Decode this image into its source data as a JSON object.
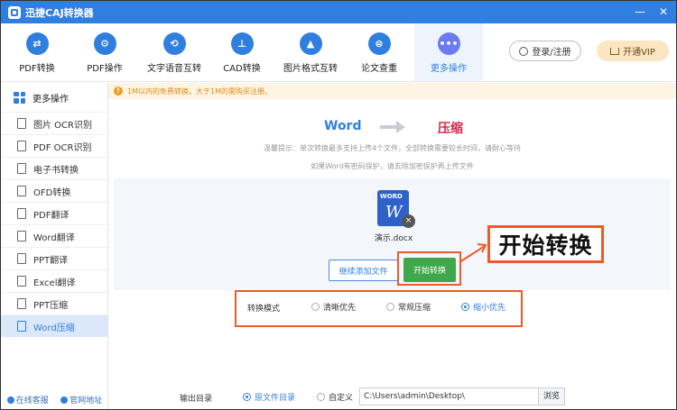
{
  "app": {
    "title": "迅捷CAJ转换器"
  },
  "window_controls": {
    "minimize": "—",
    "close": "✕"
  },
  "toolbar": {
    "tools": [
      {
        "label": "PDF转换",
        "icon": "swap-icon",
        "glyph": "⇄"
      },
      {
        "label": "PDF操作",
        "icon": "gear-icon",
        "glyph": "⚙"
      },
      {
        "label": "文字语音互转",
        "icon": "voice-icon",
        "glyph": "⟲"
      },
      {
        "label": "CAD转换",
        "icon": "cad-icon",
        "glyph": "⊥"
      },
      {
        "label": "图片格式互转",
        "icon": "image-icon",
        "glyph": "▲"
      },
      {
        "label": "论文查重",
        "icon": "check-icon",
        "glyph": "⊜"
      },
      {
        "label": "更多操作",
        "icon": "more-icon",
        "glyph": "•••"
      }
    ],
    "login_label": "登录/注册",
    "vip_label": "开通VIP"
  },
  "sidebar": {
    "header": "更多操作",
    "items": [
      {
        "label": "图片 OCR识别"
      },
      {
        "label": "PDF OCR识别"
      },
      {
        "label": "电子书转换"
      },
      {
        "label": "OFD转换"
      },
      {
        "label": "PDF翻译"
      },
      {
        "label": "Word翻译"
      },
      {
        "label": "PPT翻译"
      },
      {
        "label": "Excel翻译"
      },
      {
        "label": "PPT压缩"
      },
      {
        "label": "Word压缩"
      }
    ],
    "footer": {
      "service": "在线客服",
      "website": "官网地址"
    }
  },
  "notice": {
    "icon": "!",
    "text": "1M以内的免费转换，大于1M的需购买注册。"
  },
  "conversion": {
    "from": "Word",
    "to": "压缩"
  },
  "tips": {
    "line1": "温馨提示：单次转换最多支持上传4个文件，全部转换需要较长时间，请耐心等待",
    "line2": "如果Word有密码保护，请去除加密保护再上传文件"
  },
  "file": {
    "type_label": "WORD",
    "letter": "W",
    "name": "演示.docx",
    "remove": "×"
  },
  "buttons": {
    "add": "继续添加文件",
    "start": "开始转换"
  },
  "callout": "开始转换",
  "mode": {
    "label": "转换模式",
    "options": [
      {
        "label": "清晰优先",
        "selected": false
      },
      {
        "label": "常规压缩",
        "selected": false
      },
      {
        "label": "缩小优先",
        "selected": true
      }
    ]
  },
  "output": {
    "label": "输出目录",
    "original_dir": "原文件目录",
    "custom": "自定义",
    "path": "C:\\Users\\admin\\Desktop\\",
    "browse": "浏览"
  },
  "colors": {
    "brand": "#2f7fe0",
    "highlight": "#f05a28",
    "start": "#3fa84a",
    "target": "#d9264c"
  }
}
